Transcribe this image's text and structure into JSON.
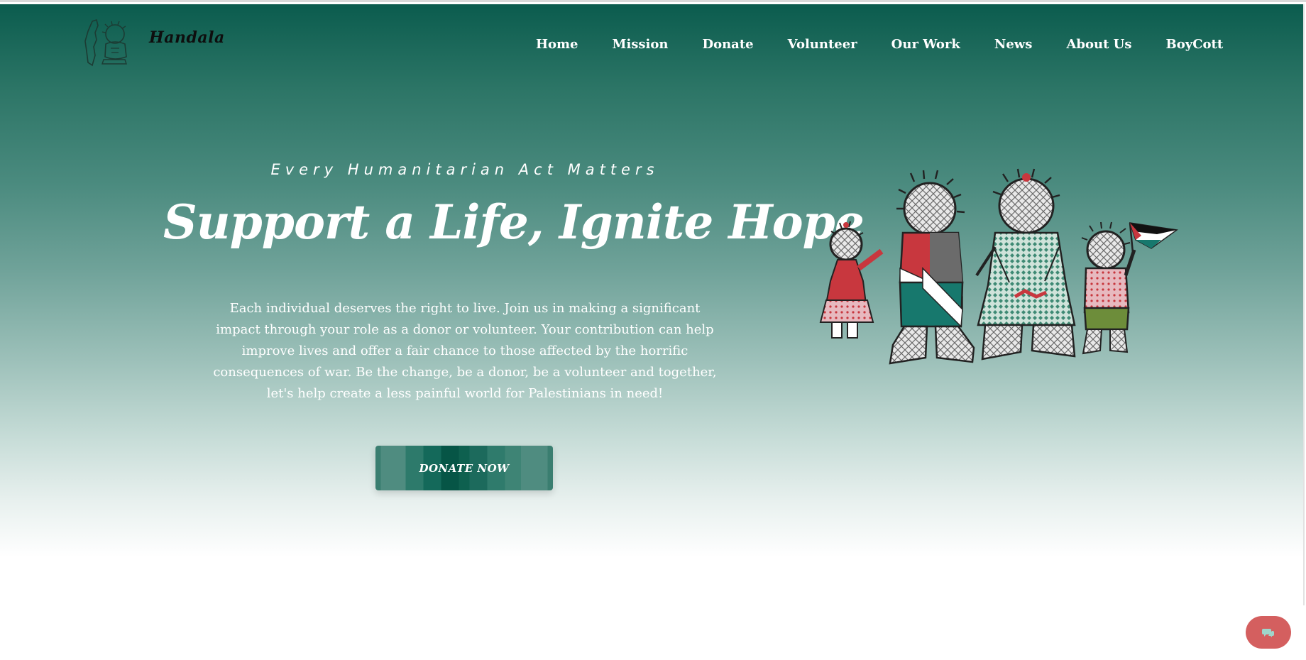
{
  "brand": {
    "name": "Handala"
  },
  "nav": {
    "items": [
      "Home",
      "Mission",
      "Donate",
      "Volunteer",
      "Our Work",
      "News",
      "About Us",
      "BoyCott"
    ]
  },
  "hero": {
    "kicker": "Every Humanitarian Act Matters",
    "headline": "Support a Life, Ignite Hope",
    "paragraph": "Each individual deserves the right to live. Join us in making a significant impact through your role as a donor or volunteer. Your contribution can help improve lives and offer a fair chance to those affected by the horrific consequences of war. Be the change, be a donor, be a volunteer and together, let's help create a less painful world for Palestinians in need!",
    "cta_label": "DONATE NOW"
  },
  "icons": {
    "logo": "handala-logo-icon",
    "illustration": "handala-family-illustration",
    "chat": "chat-bubble-icon"
  },
  "colors": {
    "primary": "#0b5c4e",
    "accent": "#d45f5f"
  }
}
